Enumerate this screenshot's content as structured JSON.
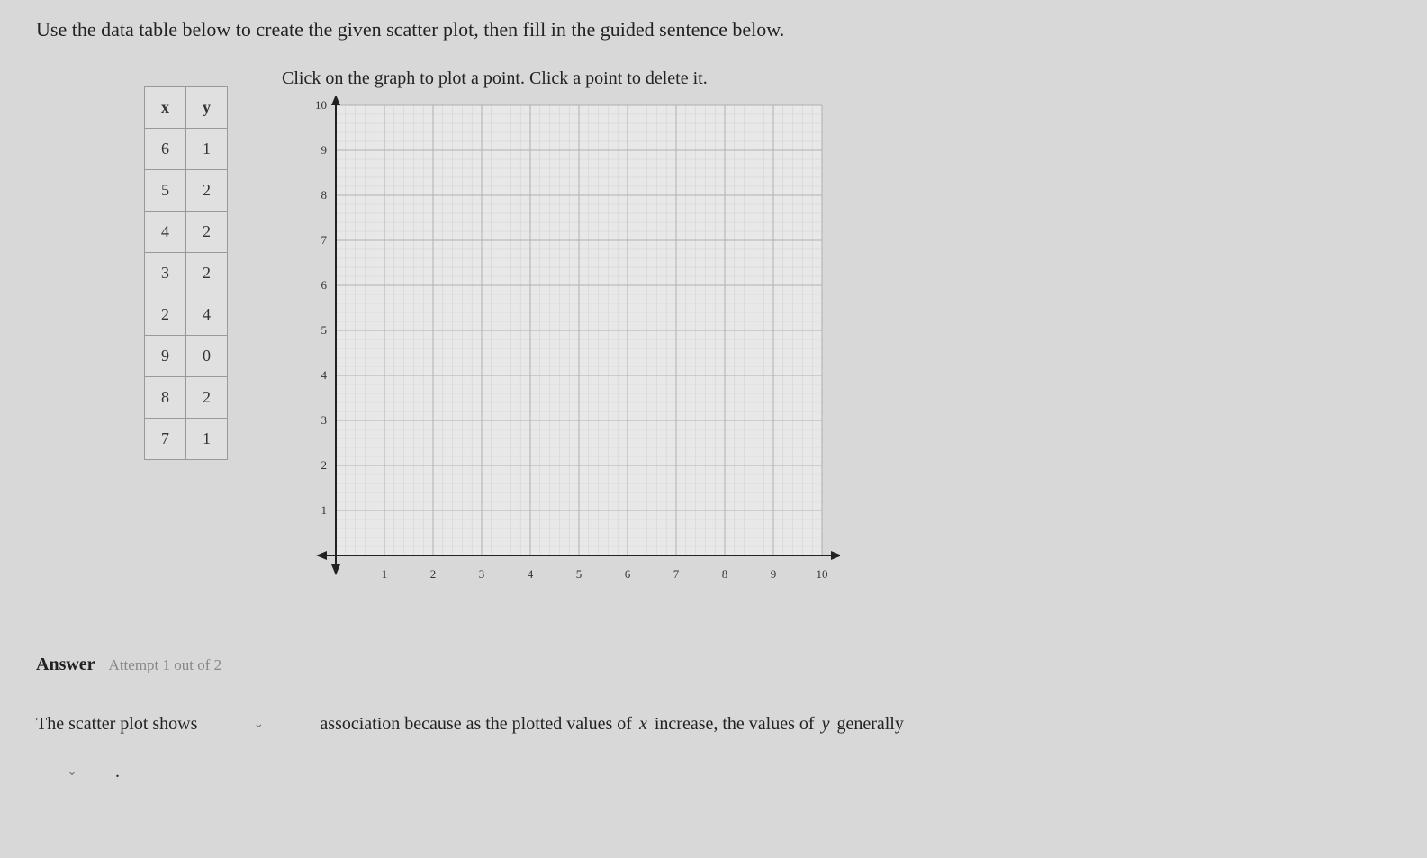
{
  "question": "Use the data table below to create the given scatter plot, then fill in the guided sentence below.",
  "table": {
    "headers": {
      "x": "x",
      "y": "y"
    },
    "rows": [
      {
        "x": "6",
        "y": "1"
      },
      {
        "x": "5",
        "y": "2"
      },
      {
        "x": "4",
        "y": "2"
      },
      {
        "x": "3",
        "y": "2"
      },
      {
        "x": "2",
        "y": "4"
      },
      {
        "x": "9",
        "y": "0"
      },
      {
        "x": "8",
        "y": "2"
      },
      {
        "x": "7",
        "y": "1"
      }
    ]
  },
  "graph": {
    "instruction": "Click on the graph to plot a point. Click a point to delete it.",
    "x_ticks": [
      "1",
      "2",
      "3",
      "4",
      "5",
      "6",
      "7",
      "8",
      "9",
      "10"
    ],
    "y_ticks": [
      "1",
      "2",
      "3",
      "4",
      "5",
      "6",
      "7",
      "8",
      "9",
      "10"
    ]
  },
  "answer": {
    "label": "Answer",
    "attempt": "Attempt 1 out of 2",
    "sentence_part1": "The scatter plot shows",
    "sentence_part2": "association because as the plotted values of",
    "var_x": "x",
    "sentence_part3": "increase, the values of",
    "var_y": "y",
    "sentence_part4": "generally",
    "period": "."
  },
  "chart_data": {
    "type": "scatter",
    "title": "",
    "xlabel": "",
    "ylabel": "",
    "xlim": [
      0,
      10
    ],
    "ylim": [
      0,
      10
    ],
    "x": [],
    "y": [],
    "note": "Graph is empty; user is expected to plot the points from the data table."
  }
}
